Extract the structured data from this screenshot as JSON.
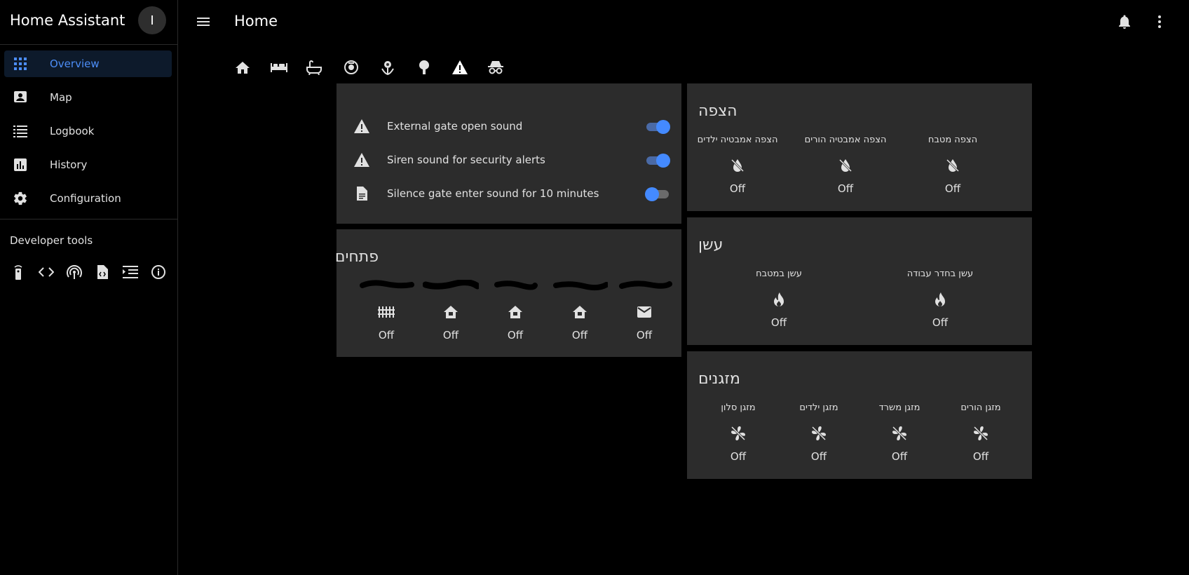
{
  "app": {
    "title": "Home Assistant",
    "avatar_initial": "I"
  },
  "sidebar": {
    "items": [
      {
        "label": "Overview",
        "icon": "grid-icon",
        "active": true
      },
      {
        "label": "Map",
        "icon": "map-icon"
      },
      {
        "label": "Logbook",
        "icon": "list-icon"
      },
      {
        "label": "History",
        "icon": "chart-icon"
      },
      {
        "label": "Configuration",
        "icon": "gear-icon"
      }
    ],
    "developer_title": "Developer tools",
    "developer_icons": [
      "remote-icon",
      "code-icon",
      "broadcast-icon",
      "file-code-icon",
      "format-list-icon",
      "info-icon"
    ]
  },
  "header": {
    "title": "Home"
  },
  "tabs": [
    {
      "icon": "home-icon"
    },
    {
      "icon": "bed-icon"
    },
    {
      "icon": "bathtub-icon"
    },
    {
      "icon": "robot-vacuum-icon"
    },
    {
      "icon": "flower-icon"
    },
    {
      "icon": "tree-icon"
    },
    {
      "icon": "alert-icon",
      "active": true
    },
    {
      "icon": "incognito-icon"
    }
  ],
  "switches_card": {
    "rows": [
      {
        "name": "External gate open sound",
        "icon": "alert-icon",
        "state": "on"
      },
      {
        "name": "Siren sound for security alerts",
        "icon": "alert-icon",
        "state": "on"
      },
      {
        "name": "Silence gate enter sound for 10 minutes",
        "icon": "file-icon",
        "state": "off"
      }
    ]
  },
  "doors_card": {
    "title": "פתחים",
    "entities": [
      {
        "icon": "gate-icon",
        "state": "Off"
      },
      {
        "icon": "home-lock-icon",
        "state": "Off"
      },
      {
        "icon": "home-lock-icon",
        "state": "Off"
      },
      {
        "icon": "home-lock-icon",
        "state": "Off"
      },
      {
        "icon": "mail-icon",
        "state": "Off"
      }
    ]
  },
  "flood_card": {
    "title": "הצפה",
    "entities": [
      {
        "name": "הצפה מטבח",
        "icon": "water-off-icon",
        "state": "Off"
      },
      {
        "name": "הצפה אמבטיה הורים",
        "icon": "water-off-icon",
        "state": "Off"
      },
      {
        "name": "הצפה אמבטיה ילדים",
        "icon": "water-off-icon",
        "state": "Off"
      }
    ]
  },
  "smoke_card": {
    "title": "עשן",
    "entities": [
      {
        "name": "עשן בחדר עבודה",
        "icon": "fire-icon",
        "state": "Off"
      },
      {
        "name": "עשן במטבח",
        "icon": "fire-icon",
        "state": "Off"
      }
    ]
  },
  "ac_card": {
    "title": "מזגנים",
    "entities": [
      {
        "name": "מזגן הורים",
        "icon": "fan-off-icon",
        "state": "Off"
      },
      {
        "name": "מזגן משרד",
        "icon": "fan-off-icon",
        "state": "Off"
      },
      {
        "name": "מזגן ילדים",
        "icon": "fan-off-icon",
        "state": "Off"
      },
      {
        "name": "מזגן סלון",
        "icon": "fan-off-icon",
        "state": "Off"
      }
    ]
  },
  "colors": {
    "accent": "#448aff",
    "card": "#2c2c2c",
    "background": "#000000"
  }
}
